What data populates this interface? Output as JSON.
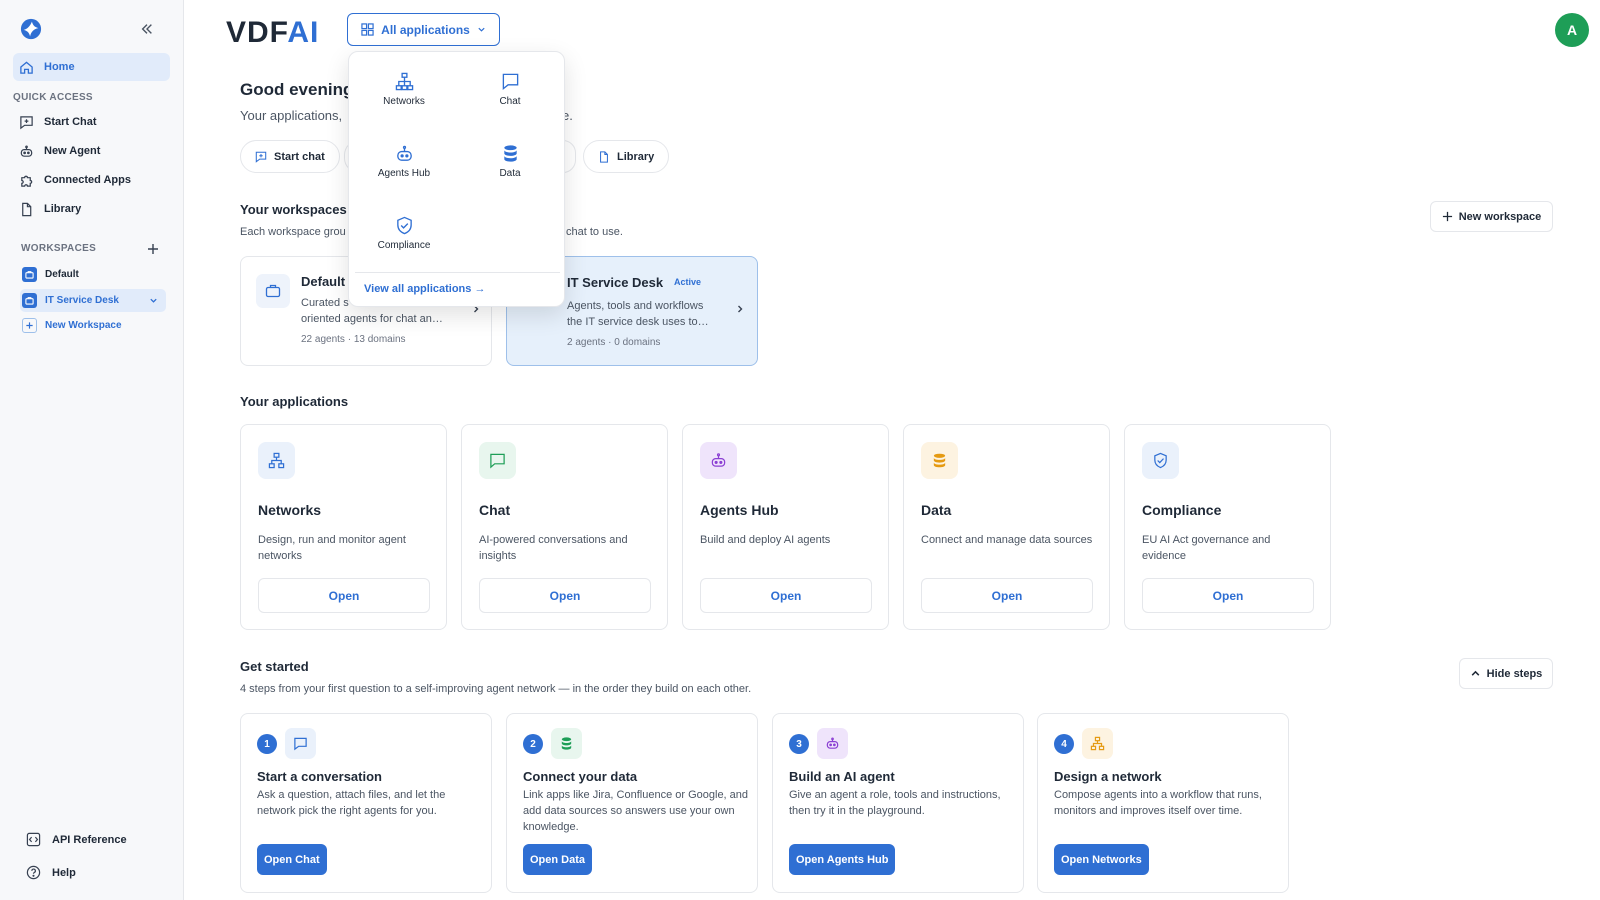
{
  "brand": {
    "name_prefix": "VDF",
    "name_suffix": "AI"
  },
  "sidebar": {
    "home": "Home",
    "quick_access_title": "QUICK ACCESS",
    "quick_items": [
      {
        "label": "Start Chat",
        "icon": "message-plus-icon"
      },
      {
        "label": "New Agent",
        "icon": "robot-icon"
      },
      {
        "label": "Connected Apps",
        "icon": "puzzle-icon"
      },
      {
        "label": "Library",
        "icon": "document-icon"
      }
    ],
    "workspaces_title": "WORKSPACES",
    "workspaces": [
      "Default",
      "IT Service Desk"
    ],
    "new_workspace": "New Workspace",
    "api_reference": "API Reference",
    "help": "Help"
  },
  "header": {
    "apps_button": "All applications",
    "avatar_letter": "A"
  },
  "dropdown": {
    "items": [
      "Networks",
      "Chat",
      "Agents Hub",
      "Data",
      "Compliance"
    ],
    "view_all": "View all applications →"
  },
  "greeting": {
    "title": "Good evening,",
    "subtitle_start": "Your applications,",
    "subtitle_end": "e."
  },
  "pills": {
    "start_chat": "Start chat",
    "library": "Library"
  },
  "workspaces_section": {
    "title": "Your workspaces",
    "desc_start": "Each workspace grou",
    "desc_end": "chat to use.",
    "new_button": "New workspace",
    "cards": [
      {
        "title": "Default",
        "desc_line1": "Curated s",
        "desc_line2": "oriented agents for chat an…",
        "meta": "22 agents · 13 domains"
      },
      {
        "title": "IT Service Desk",
        "badge": "Active",
        "desc_line1": "Agents, tools and workflows",
        "desc_line2": "the IT service desk uses to…",
        "meta": "2 agents · 0 domains"
      }
    ]
  },
  "applications_section": {
    "title": "Your applications",
    "open_label": "Open",
    "apps": [
      {
        "title": "Networks",
        "desc": "Design, run and monitor agent networks",
        "icon": "network-icon",
        "color": "#2f6fd3",
        "bg": "#eaf1fb"
      },
      {
        "title": "Chat",
        "desc": "AI-powered conversations and insights",
        "icon": "chat-icon",
        "color": "#1e9e57",
        "bg": "#e8f6ee"
      },
      {
        "title": "Agents Hub",
        "desc": "Build and deploy AI agents",
        "icon": "robot-icon",
        "color": "#8b3fd3",
        "bg": "#efe4fb"
      },
      {
        "title": "Data",
        "desc": "Connect and manage data sources",
        "icon": "database-icon",
        "color": "#e59a12",
        "bg": "#fdf3e1"
      },
      {
        "title": "Compliance",
        "desc": "EU AI Act governance and evidence",
        "icon": "shield-check-icon",
        "color": "#2f6fd3",
        "bg": "#eaf1fb"
      }
    ]
  },
  "get_started": {
    "title": "Get started",
    "desc": "4 steps from your first question to a self-improving agent network — in the order they build on each other.",
    "hide_button": "Hide steps",
    "steps": [
      {
        "num": "1",
        "title": "Start a conversation",
        "desc": "Ask a question, attach files, and let the network pick the right agents for you.",
        "button": "Open Chat",
        "icon": "chat-icon",
        "color": "#2f6fd3",
        "bg": "#eaf1fb"
      },
      {
        "num": "2",
        "title": "Connect your data",
        "desc": "Link apps like Jira, Confluence or Google, and add data sources so answers use your own knowledge.",
        "button": "Open Data",
        "icon": "database-icon",
        "color": "#1e9e57",
        "bg": "#e8f6ee"
      },
      {
        "num": "3",
        "title": "Build an AI agent",
        "desc": "Give an agent a role, tools and instructions, then try it in the playground.",
        "button": "Open Agents Hub",
        "icon": "robot-icon",
        "color": "#8b3fd3",
        "bg": "#efe4fb"
      },
      {
        "num": "4",
        "title": "Design a network",
        "desc": "Compose agents into a workflow that runs, monitors and improves itself over time.",
        "button": "Open Networks",
        "icon": "network-icon",
        "color": "#e59a12",
        "bg": "#fdf3e1"
      }
    ]
  }
}
